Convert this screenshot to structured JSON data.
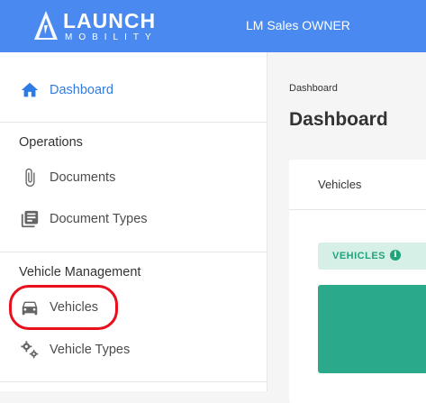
{
  "header": {
    "logo_word1": "LAUNCH",
    "logo_word2": "MOBILITY",
    "user_name": "LM Sales OWNER",
    "bar_color": "#4a8af0"
  },
  "sidebar": {
    "dashboard": {
      "label": "Dashboard",
      "icon": "home-icon",
      "active": true
    },
    "operations_title": "Operations",
    "operations": [
      {
        "label": "Documents",
        "icon": "paperclip-icon"
      },
      {
        "label": "Document Types",
        "icon": "library-books-icon"
      }
    ],
    "vehicle_management_title": "Vehicle Management",
    "vehicle_management": [
      {
        "label": "Vehicles",
        "icon": "car-icon",
        "highlighted": true
      },
      {
        "label": "Vehicle Types",
        "icon": "gears-icon"
      }
    ],
    "active_color": "#2f7be5",
    "highlight_color": "#e8101d"
  },
  "main": {
    "breadcrumb": "Dashboard",
    "title": "Dashboard",
    "card": {
      "tab_label": "Vehicles",
      "badge_label": "VEHICLES",
      "badge_icon": "info-icon",
      "accent_color": "#2aaa8a"
    }
  }
}
